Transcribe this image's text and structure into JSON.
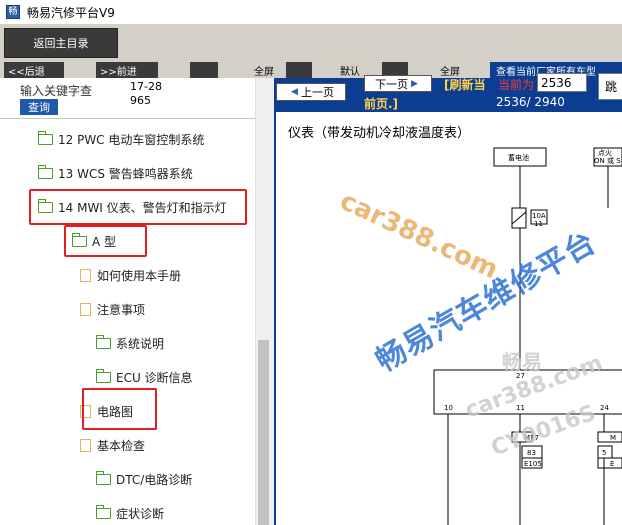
{
  "window": {
    "title": "畅易汽修平台V9",
    "icon": "app-icon"
  },
  "toolbar": {
    "back_main": "返回主目录"
  },
  "row2": {
    "back": "<<后退",
    "forward": ">>前进",
    "all1": "全屏",
    "default": "默认",
    "all2": "全屏",
    "banner": "查看当前厂家所有车型"
  },
  "search": {
    "label": "输入关键字查",
    "button": "查询",
    "value": "17-28965"
  },
  "tree": [
    {
      "label": "12 PWC 电动车窗控制系统",
      "type": "folder"
    },
    {
      "label": "13 WCS 警告蜂鸣器系统",
      "type": "folder"
    },
    {
      "label": "14 MWI 仪表、警告灯和指示灯",
      "type": "folder"
    },
    {
      "label": "A 型",
      "type": "folder"
    },
    {
      "label": "如何使用本手册",
      "type": "doc"
    },
    {
      "label": "注意事项",
      "type": "doc"
    },
    {
      "label": "系统说明",
      "type": "folder"
    },
    {
      "label": "ECU 诊断信息",
      "type": "folder"
    },
    {
      "label": "电路图",
      "type": "doc"
    },
    {
      "label": "基本检查",
      "type": "doc"
    },
    {
      "label": "DTC/电路诊断",
      "type": "folder"
    },
    {
      "label": "症状诊断",
      "type": "folder"
    }
  ],
  "viewer": {
    "prev": "上一页",
    "next": "下一页",
    "refresh": "[刷新当前页.]",
    "refresh_a": "[刷新当",
    "refresh_b": "前页.]",
    "current_label": "当前为",
    "current_page": "2536",
    "total": "2536/ 2940",
    "jump": "跳",
    "doc_title": "仪表（带发动机冷却液温度表）"
  },
  "schematic": {
    "battery": "蓄电池",
    "ign": "点火",
    "ign2": "ON 或 S",
    "fuse_amp": "10A",
    "fuse_no": "11",
    "pin27": "27",
    "pin10": "10",
    "pin11": "11",
    "pin24": "24",
    "c1": "M77",
    "c2": "83",
    "c3": "E105",
    "c4": "M",
    "c5": "5",
    "c6": "E"
  },
  "watermarks": {
    "w1": "car388.com",
    "w2": "畅易汽车维修平台",
    "w3": "畅易",
    "w4": "car388.com",
    "w5": "CY0016S"
  },
  "colors": {
    "highlight": "#e02020",
    "viewer_bg": "#0b3d91",
    "folder": "#4a9c2e",
    "doc": "#e8b25a",
    "link": "#ffd24a",
    "page_label": "#ff3a3a"
  }
}
